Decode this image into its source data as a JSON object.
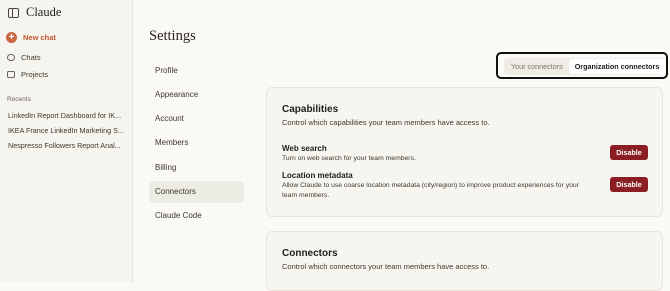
{
  "app": {
    "name": "Claude"
  },
  "sidebar": {
    "new_chat": "New chat",
    "items": [
      {
        "label": "Chats"
      },
      {
        "label": "Projects"
      }
    ],
    "recents_title": "Recents",
    "recents": [
      "LinkedIn Report Dashboard for IK...",
      "IKEA France LinkedIn Marketing S...",
      "Nespresso Followers Report Anal..."
    ]
  },
  "settings": {
    "title": "Settings",
    "menu": [
      "Profile",
      "Appearance",
      "Account",
      "Members",
      "Billing",
      "Connectors",
      "Claude Code"
    ],
    "active_menu": "Connectors"
  },
  "tabs": {
    "items": [
      "Your connectors",
      "Organization connectors"
    ],
    "active": "Organization connectors"
  },
  "capabilities": {
    "title": "Capabilities",
    "subtitle": "Control which capabilities your team members have access to.",
    "rows": [
      {
        "title": "Web search",
        "description": "Turn on web search for your team members.",
        "button": "Disable"
      },
      {
        "title": "Location metadata",
        "description": "Allow Claude to use coarse location metadata (city/region) to improve product experiences for your team members.",
        "button": "Disable"
      }
    ]
  },
  "connectors": {
    "title": "Connectors",
    "subtitle": "Control which connectors your team members have access to."
  },
  "colors": {
    "accent": "#c96442",
    "danger_button": "#8b1d24",
    "background": "#faf9f5"
  }
}
